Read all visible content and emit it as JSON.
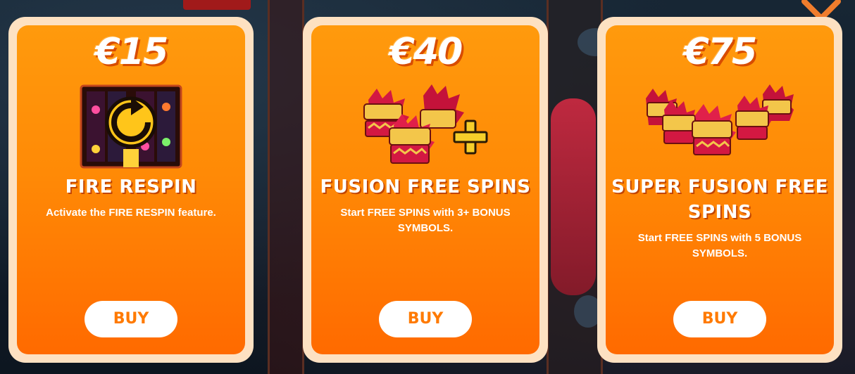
{
  "offers": [
    {
      "price": "€15",
      "title": "FIRE RESPIN",
      "description": "Activate the FIRE RESPIN feature.",
      "buy_label": "BUY",
      "icon": "respin-icon"
    },
    {
      "price": "€40",
      "title": "FUSION FREE SPINS",
      "description": "Start FREE SPINS with 3+ BONUS SYMBOLS.",
      "buy_label": "BUY",
      "icon": "dragon-heads-plus-icon"
    },
    {
      "price": "€75",
      "title": "SUPER FUSION FREE SPINS",
      "description": "Start FREE SPINS with 5 BONUS SYMBOLS.",
      "buy_label": "BUY",
      "icon": "five-dragon-heads-icon"
    }
  ],
  "close_icon": "close-icon",
  "colors": {
    "card_orange": "#ff8a06",
    "card_border": "#fde1c2",
    "button_text": "#ff7a00",
    "close": "#f07d2c"
  }
}
